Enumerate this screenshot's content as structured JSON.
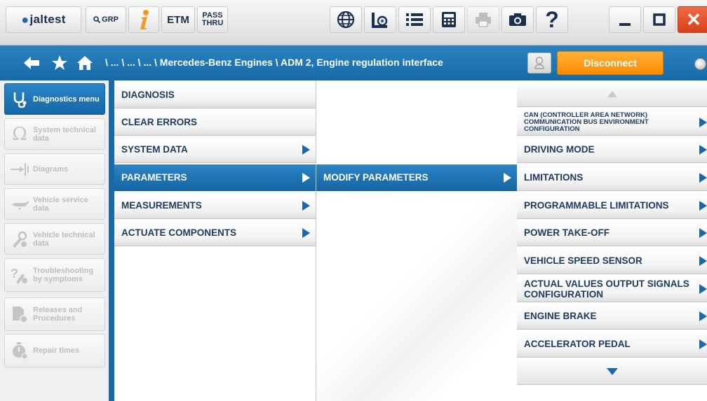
{
  "toolbar": {
    "logo": "jaltest",
    "grp_label": "GRP",
    "etm_label": "ETM",
    "pass_label_1": "PASS",
    "pass_label_2": "THRU",
    "help_label": "?",
    "close_label": "✕"
  },
  "nav": {
    "breadcrumb": "\\ ... \\ ... \\ ... \\ Mercedes-Benz Engines \\ ADM 2, Engine regulation interface",
    "disconnect_label": "Disconnect"
  },
  "sidebar": {
    "items": [
      {
        "label": "Diagnostics menu",
        "icon": "stethoscope-icon",
        "active": true
      },
      {
        "label": "System technical data",
        "icon": "omega-icon",
        "active": false
      },
      {
        "label": "Diagrams",
        "icon": "diagram-icon",
        "active": false
      },
      {
        "label": "Vehicle service data",
        "icon": "oil-can-icon",
        "active": false
      },
      {
        "label": "Vehicle technical data",
        "icon": "wrench-gear-icon",
        "active": false
      },
      {
        "label": "Troubleshooting by symptoms",
        "icon": "troubleshooting-icon",
        "active": false
      },
      {
        "label": "Releases and Procedures",
        "icon": "procedures-icon",
        "active": false
      },
      {
        "label": "Repair times",
        "icon": "stopwatch-icon",
        "active": false
      }
    ]
  },
  "menu1": {
    "items": [
      {
        "label": "DIAGNOSIS",
        "arrow": false,
        "active": false
      },
      {
        "label": "CLEAR ERRORS",
        "arrow": false,
        "active": false
      },
      {
        "label": "SYSTEM DATA",
        "arrow": true,
        "active": false
      },
      {
        "label": "PARAMETERS",
        "arrow": true,
        "active": true
      },
      {
        "label": "MEASUREMENTS",
        "arrow": true,
        "active": false
      },
      {
        "label": "ACTUATE COMPONENTS",
        "arrow": true,
        "active": false
      }
    ]
  },
  "menu2": {
    "items": [
      {
        "label": "MODIFY PARAMETERS",
        "arrow": true,
        "active": true
      }
    ]
  },
  "menu3": {
    "items": [
      {
        "label": "CAN (CONTROLLER AREA NETWORK) COMMUNICATION BUS ENVIRONMENT CONFIGURATION"
      },
      {
        "label": "DRIVING MODE"
      },
      {
        "label": "LIMITATIONS"
      },
      {
        "label": "PROGRAMMABLE LIMITATIONS"
      },
      {
        "label": "POWER TAKE-OFF"
      },
      {
        "label": "VEHICLE SPEED SENSOR"
      },
      {
        "label": "ACTUAL VALUES OUTPUT SIGNALS CONFIGURATION"
      },
      {
        "label": "ENGINE BRAKE"
      },
      {
        "label": "ACCELERATOR PEDAL"
      }
    ]
  },
  "colors": {
    "accent_blue": "#1b6fae",
    "orange": "#ff9a1a",
    "close_red": "#e2471f",
    "menu_text": "#1c3b5e"
  }
}
